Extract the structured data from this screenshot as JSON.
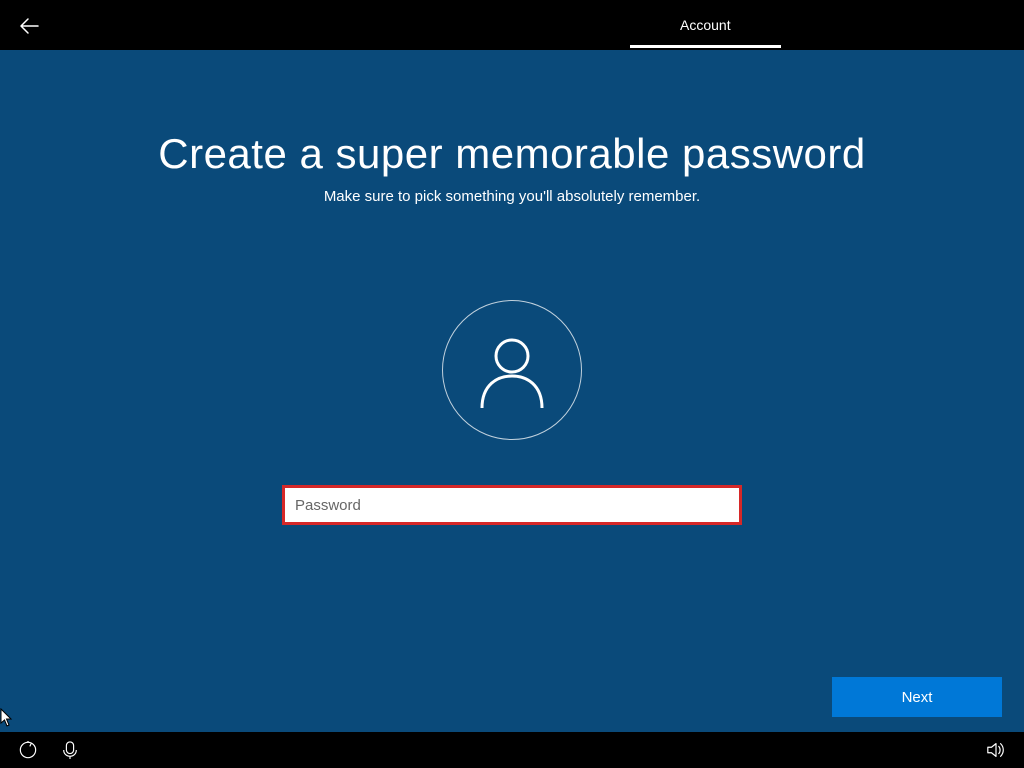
{
  "topbar": {
    "tab_label": "Account"
  },
  "page": {
    "title": "Create a super memorable password",
    "subtitle": "Make sure to pick something you'll absolutely remember."
  },
  "form": {
    "password_placeholder": "Password",
    "password_value": ""
  },
  "actions": {
    "next_label": "Next"
  }
}
